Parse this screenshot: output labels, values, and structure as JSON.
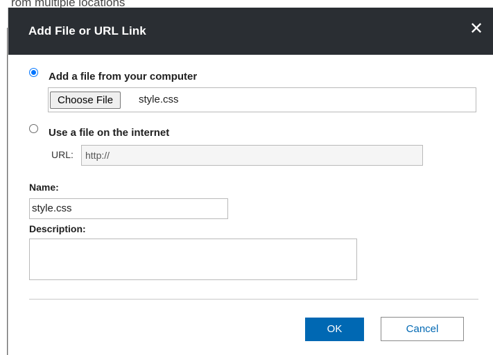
{
  "background": {
    "partial_text": "rom multiple locations"
  },
  "dialog": {
    "title": "Add File or URL Link",
    "close_glyph": "✕",
    "options": {
      "file_from_computer_label": "Add a file from your computer",
      "file_from_computer_selected": true,
      "file_on_internet_label": "Use a file on the internet",
      "file_on_internet_selected": false
    },
    "file_picker": {
      "button_label": "Choose File",
      "selected_file": "style.css"
    },
    "url": {
      "label": "URL:",
      "value": "http://"
    },
    "name": {
      "label": "Name:",
      "value": "style.css"
    },
    "description": {
      "label": "Description:",
      "value": ""
    },
    "buttons": {
      "ok_label": "OK",
      "cancel_label": "Cancel"
    },
    "colors": {
      "titlebar_bg": "#2a2e33",
      "primary_button": "#0068b3",
      "radio_accent": "#0075ff"
    }
  }
}
